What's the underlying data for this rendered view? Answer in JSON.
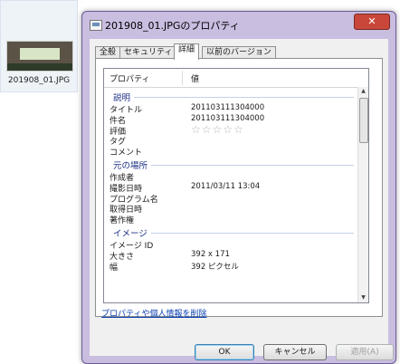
{
  "desktop": {
    "file_label": "201908_01.JPG"
  },
  "window": {
    "title": "201908_01.JPGのプロパティ",
    "close_label": "✕",
    "tabs": [
      "全般",
      "セキュリティ",
      "詳細",
      "以前のバージョン"
    ],
    "active_tab": "詳細",
    "list_header": {
      "property": "プロパティ",
      "value": "値"
    },
    "sections": [
      {
        "title": "説明",
        "rows": [
          {
            "key": "タイトル",
            "value": "201103111304000"
          },
          {
            "key": "件名",
            "value": "201103111304000"
          },
          {
            "key": "評価",
            "value": "☆☆☆☆☆"
          },
          {
            "key": "タグ",
            "value": ""
          },
          {
            "key": "コメント",
            "value": ""
          }
        ]
      },
      {
        "title": "元の場所",
        "rows": [
          {
            "key": "作成者",
            "value": ""
          },
          {
            "key": "撮影日時",
            "value": "2011/03/11 13:04"
          },
          {
            "key": "プログラム名",
            "value": ""
          },
          {
            "key": "取得日時",
            "value": ""
          },
          {
            "key": "著作権",
            "value": ""
          }
        ]
      },
      {
        "title": "イメージ",
        "rows": [
          {
            "key": "イメージ ID",
            "value": ""
          },
          {
            "key": "大きさ",
            "value": "392 x 171"
          },
          {
            "key": "幅",
            "value": "392 ピクセル"
          }
        ]
      }
    ],
    "remove_link": "プロパティや個人情報を削除",
    "buttons": {
      "ok": "OK",
      "cancel": "キャンセル",
      "apply": "適用(A)"
    }
  }
}
